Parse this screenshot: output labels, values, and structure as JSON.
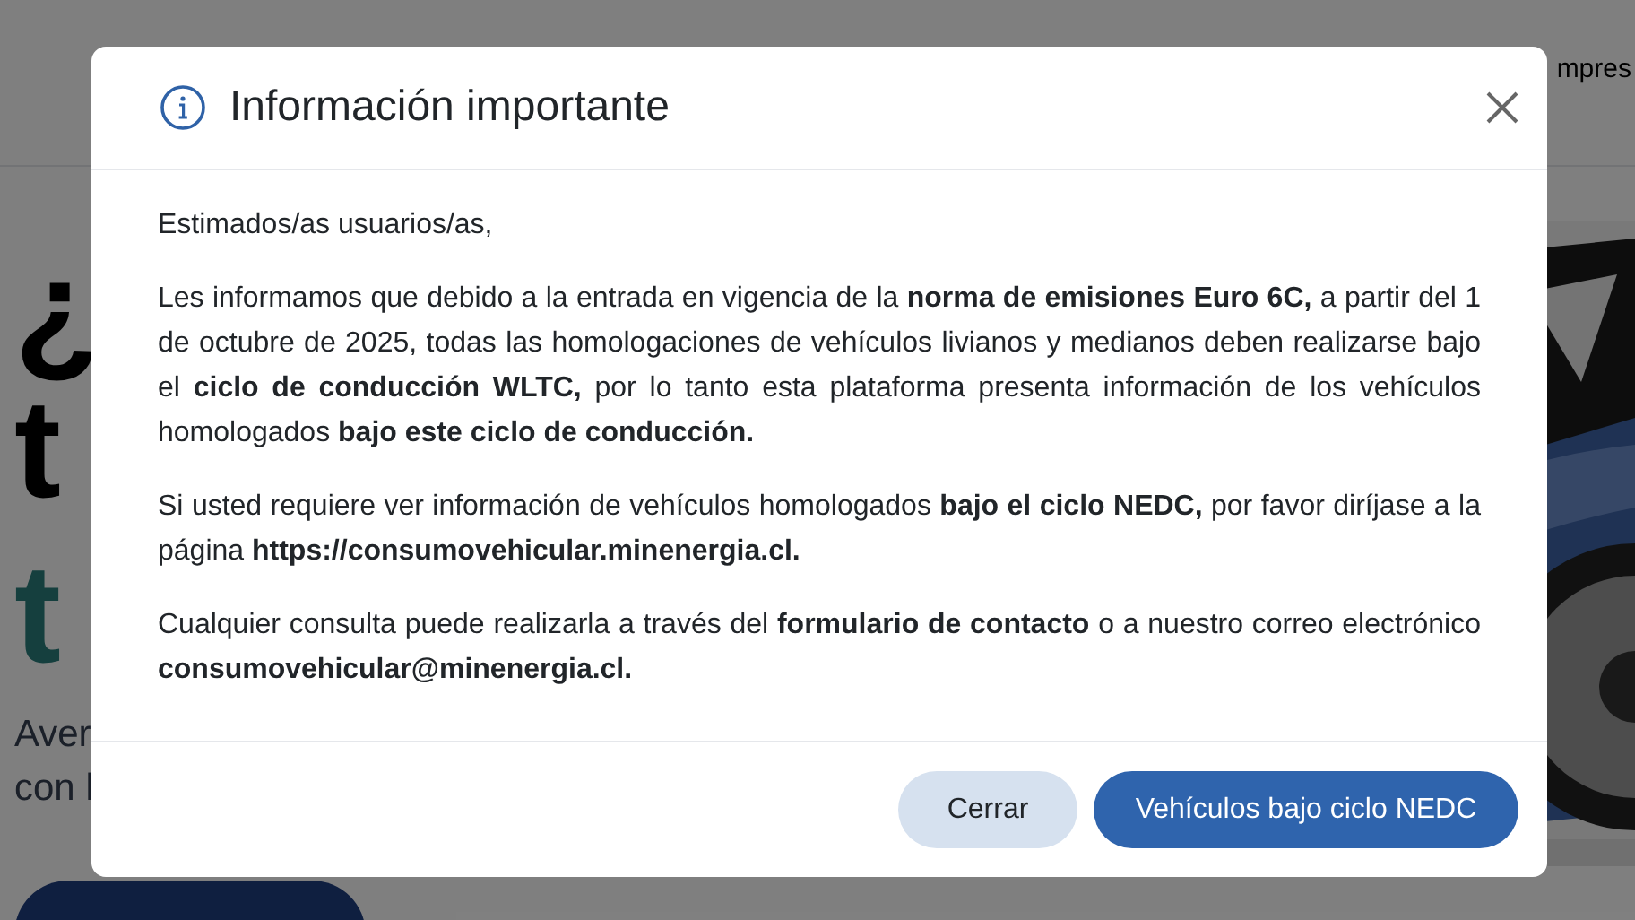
{
  "background": {
    "header_link": "mpres",
    "hero_lines": [
      "¿",
      "t",
      "t"
    ],
    "subtitle_lines": [
      "Aver",
      "con l"
    ],
    "cta": {
      "kind": "button"
    }
  },
  "modal": {
    "title": "Información importante",
    "paragraphs": [
      "Estimados/as usuarios/as,",
      "Les informamos que debido a la entrada en vigencia de la **norma de emisiones Euro 6C,** a partir del 1 de octubre de 2025, todas las homologaciones de vehículos livianos y medianos deben realizarse bajo el **ciclo de conducción WLTC,** por lo tanto esta plataforma presenta información de los vehículos homologados **bajo este ciclo de conducción.**",
      "Si usted requiere ver información de vehículos homologados **bajo el ciclo NEDC,** por favor diríjase a la página **https://consumovehicular.minenergia.cl.**",
      "Cualquier consulta puede realizarla a través del **formulario de contacto** o a nuestro correo electrónico **consumovehicular@minenergia.cl.**"
    ],
    "buttons": [
      {
        "label": "Cerrar",
        "kind": "secondary"
      },
      {
        "label": "Vehículos bajo ciclo NEDC",
        "kind": "primary"
      }
    ]
  }
}
